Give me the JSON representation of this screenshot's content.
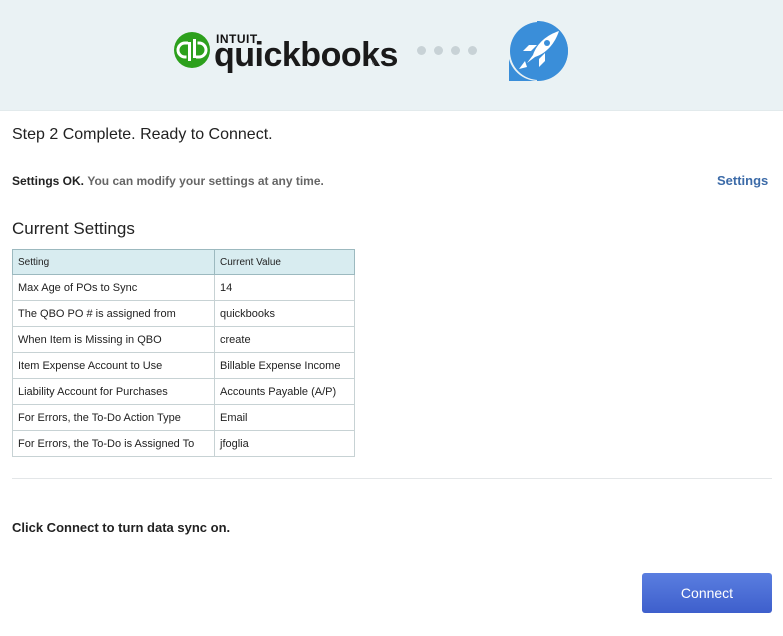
{
  "header": {
    "brand_small": "INTUIT",
    "brand_name": "quickbooks",
    "brand_mark": "®",
    "logo_icon": "quickbooks-logo-icon",
    "rocket_icon": "rocket-icon",
    "colors": {
      "qb_green": "#2ca01c",
      "rocket_blue": "#3a8ed9",
      "header_bg": "#eaf2f4"
    }
  },
  "step_title": "Step 2 Complete. Ready to Connect.",
  "status": {
    "ok_label": "Settings OK.",
    "note": "You can modify your settings at any time.",
    "settings_link": "Settings"
  },
  "current_settings": {
    "title": "Current Settings",
    "columns": [
      "Setting",
      "Current Value"
    ],
    "rows": [
      [
        "Max Age of POs to Sync",
        "14"
      ],
      [
        "The QBO PO # is assigned from",
        "quickbooks"
      ],
      [
        "When Item is Missing in QBO",
        "create"
      ],
      [
        "Item Expense Account to Use",
        "Billable Expense Income"
      ],
      [
        "Liability Account for Purchases",
        "Accounts Payable (A/P)"
      ],
      [
        "For Errors, the To-Do Action Type",
        "Email"
      ],
      [
        "For Errors, the To-Do is Assigned To",
        "jfoglia"
      ]
    ]
  },
  "footer": {
    "connect_note": "Click Connect to turn data sync on.",
    "connect_button": "Connect",
    "button_color": "#4a6dd6"
  }
}
